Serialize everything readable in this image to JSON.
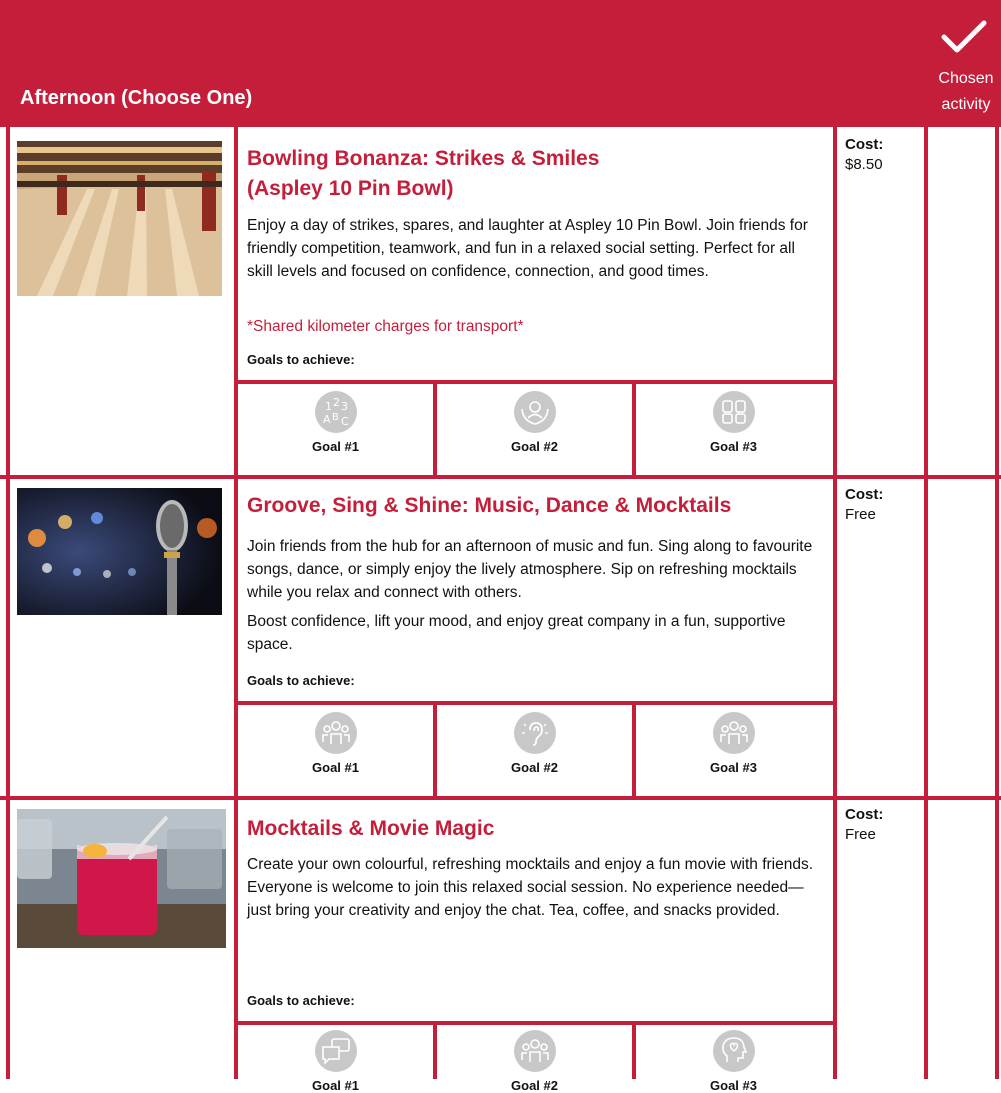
{
  "header": {
    "title": "Afternoon (Choose One)",
    "chosen_label": "Chosen activity",
    "check_icon": "checkmark-icon"
  },
  "colors": {
    "brand": "#c41e3a",
    "goal_icon_bg": "#c8c8c8",
    "text": "#111111"
  },
  "activities": [
    {
      "title_line1": "Bowling Bonanza: Strikes & Smiles",
      "title_line2": "(Aspley 10 Pin Bowl)",
      "description": "Enjoy a day of strikes, spares, and laughter at Aspley 10 Pin Bowl. Join friends for friendly competition, teamwork, and fun in a relaxed social setting. Perfect for all skill levels and focused on confidence, connection, and good times.",
      "note": "*Shared kilometer charges for transport*",
      "goals_label": "Goals to achieve:",
      "cost_label": "Cost:",
      "cost_value": "$8.50",
      "image": "bowling-alley-photo",
      "goals": [
        {
          "label": "Goal #1",
          "icon": "numbers-letters-icon"
        },
        {
          "label": "Goal #2",
          "icon": "hands-person-icon"
        },
        {
          "label": "Goal #3",
          "icon": "teamwork-hands-icon"
        }
      ]
    },
    {
      "title": "Groove, Sing & Shine: Music, Dance & Mocktails",
      "description_p1": "Join friends from the hub for an afternoon of music and fun. Sing along to favourite songs, dance, or simply enjoy the lively atmosphere. Sip on refreshing mocktails while you relax and connect with others.",
      "description_p2": "Boost confidence, lift your mood, and enjoy great company in a fun, supportive space.",
      "goals_label": "Goals to achieve:",
      "cost_label": "Cost:",
      "cost_value": "Free",
      "image": "microphone-stage-photo",
      "goals": [
        {
          "label": "Goal #1",
          "icon": "group-people-icon"
        },
        {
          "label": "Goal #2",
          "icon": "ear-listening-icon"
        },
        {
          "label": "Goal #3",
          "icon": "group-people-icon"
        }
      ]
    },
    {
      "title": "Mocktails & Movie Magic",
      "description": "Create your own colourful, refreshing mocktails and enjoy a fun movie with friends. Everyone is welcome to join this relaxed social session. No experience needed—just bring your creativity and enjoy the chat. Tea, coffee, and snacks provided.",
      "goals_label": "Goals to achieve:",
      "cost_label": "Cost:",
      "cost_value": "Free",
      "image": "red-mocktail-photo",
      "goals": [
        {
          "label": "Goal #1",
          "icon": "speech-bubbles-icon"
        },
        {
          "label": "Goal #2",
          "icon": "group-people-icon"
        },
        {
          "label": "Goal #3",
          "icon": "head-heart-icon"
        }
      ]
    }
  ]
}
